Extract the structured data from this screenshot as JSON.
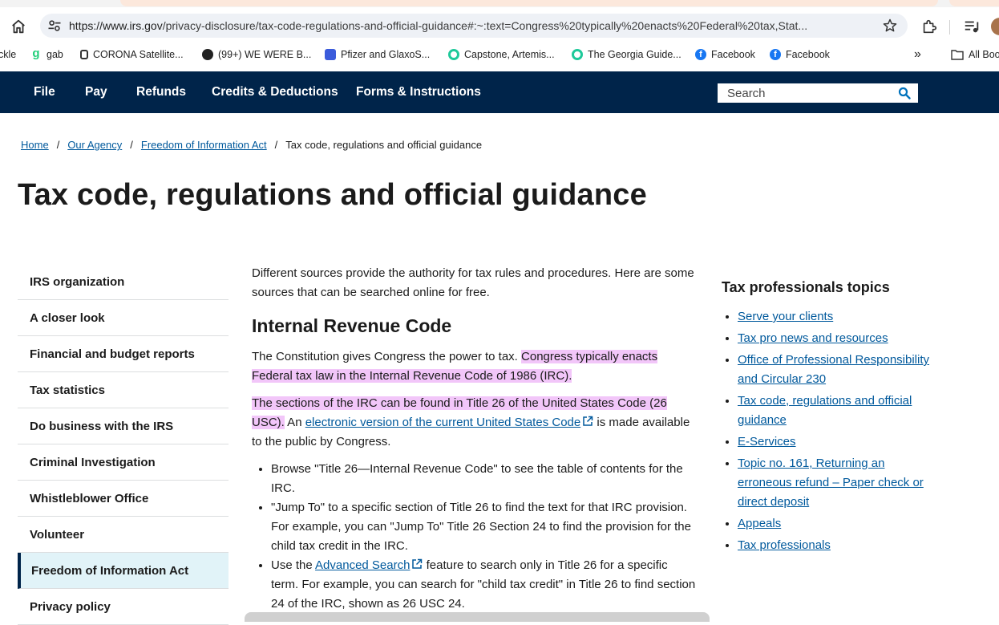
{
  "browser": {
    "url_host": "https://www.irs.gov",
    "url_path": "/privacy-disclosure/tax-code-regulations-and-official-guidance#:~:text=Congress%20typically%20enacts%20Federal%20tax,Stat...",
    "bookmarks": [
      {
        "label": "ckle",
        "icon": "cut-favicon",
        "color": "#ffffff"
      },
      {
        "label": "gab",
        "icon": "gab-icon",
        "color": "#21cf7a"
      },
      {
        "label": "CORONA Satellite...",
        "icon": "corona-icon",
        "color": "#ffffff"
      },
      {
        "label": "(99+) WE WERE B...",
        "icon": "we-were-icon",
        "color": "#222222"
      },
      {
        "label": "Pfizer and GlaxoS...",
        "icon": "pfizer-icon",
        "color": "#3b5bdb"
      },
      {
        "label": "Capstone, Artemis...",
        "icon": "capstone-icon",
        "color": "#1ec99a"
      },
      {
        "label": "The Georgia Guide...",
        "icon": "georgia-icon",
        "color": "#1ec99a"
      },
      {
        "label": "Facebook",
        "icon": "facebook-icon",
        "color": "#1877f2"
      },
      {
        "label": "Facebook",
        "icon": "facebook-icon",
        "color": "#1877f2"
      }
    ],
    "all_bookmarks_label": "All Boo"
  },
  "nav": {
    "items": [
      "File",
      "Pay",
      "Refunds",
      "Credits & Deductions",
      "Forms & Instructions"
    ],
    "search_placeholder": "Search"
  },
  "breadcrumb": {
    "links": [
      "Home",
      "Our Agency",
      "Freedom of Information Act"
    ],
    "current": "Tax code, regulations and official guidance"
  },
  "page_title": "Tax code, regulations and official guidance",
  "left_nav": {
    "items": [
      "IRS organization",
      "A closer look",
      "Financial and budget reports",
      "Tax statistics",
      "Do business with the IRS",
      "Criminal Investigation",
      "Whistleblower Office",
      "Volunteer",
      "Freedom of Information Act",
      "Privacy policy"
    ],
    "active_item": "Freedom of Information Act"
  },
  "main": {
    "intro": "Different sources provide the authority for tax rules and procedures. Here are some sources that can be searched online for free.",
    "irc_heading": "Internal Revenue Code",
    "p1_plain": "The Constitution gives Congress the power to tax. ",
    "p1_highlight": "Congress typically enacts Federal tax law in the Internal Revenue Code of 1986 (IRC).",
    "p2_highlight": "The sections of the IRC can be found in Title 26 of the United States Code (26 USC).",
    "p2_an": " An ",
    "p2_link": "electronic version of the current United States Code",
    "p2_rest": " is made available to the public by Congress.",
    "bullet1": "Browse \"Title 26—Internal Revenue Code\" to see the table of contents for the IRC.",
    "bullet2": "\"Jump To\" to a specific section of Title 26 to find the text for that IRC provision. For example, you can \"Jump To\" Title 26 Section 24 to find the provision for the child tax credit in the IRC.",
    "bullet3_pre": "Use the ",
    "bullet3_link": "Advanced Search",
    "bullet3_post": " feature to search only in Title 26 for a specific term. For example, you can search for \"child tax credit\" in Title 26 to find section 24 of the IRC, shown as 26 USC 24."
  },
  "right_sidebar": {
    "heading": "Tax professionals topics",
    "links": [
      "Serve your clients",
      "Tax pro news and resources",
      "Office of Professional Responsibility and Circular 230",
      "Tax code, regulations and official guidance",
      "E-Services",
      "Topic no. 161, Returning an erroneous refund – Paper check or direct deposit",
      "Appeals",
      "Tax professionals"
    ]
  },
  "colors": {
    "nav_bg": "#00244a",
    "link": "#00599c",
    "highlight": "#f2c6f9",
    "active_nav_bg": "#e1f3f8"
  }
}
